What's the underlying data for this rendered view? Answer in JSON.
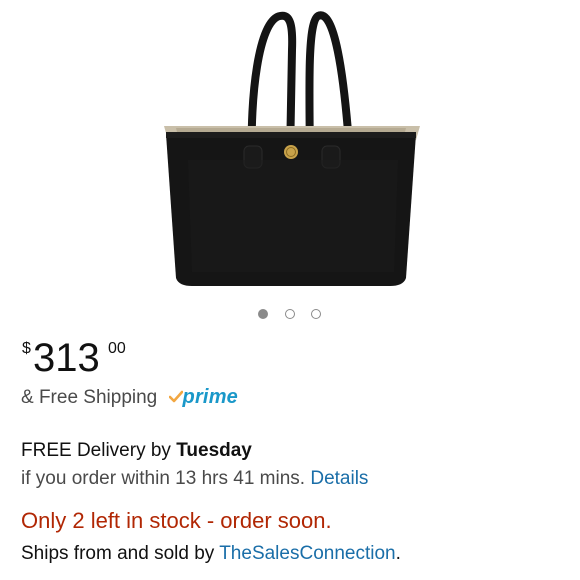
{
  "product": {
    "image_icon": "tote-bag-image"
  },
  "carousel": {
    "count": 3,
    "active_index": 0
  },
  "price": {
    "currency": "$",
    "whole": "313",
    "cents": "00"
  },
  "shipping": {
    "text": "& Free Shipping",
    "prime_label": "prime",
    "prime_color": "#1a98c9",
    "check_color": "#f2a742"
  },
  "delivery": {
    "prefix": "FREE Delivery by ",
    "day": "Tuesday",
    "order_within": "if you order within 13 hrs 41 mins.",
    "details_link": "Details"
  },
  "stock": {
    "text": "Only 2 left in stock - order soon.",
    "color": "#b12704"
  },
  "seller": {
    "prefix": "Ships from and sold by ",
    "name": "TheSalesConnection",
    "suffix": "."
  }
}
